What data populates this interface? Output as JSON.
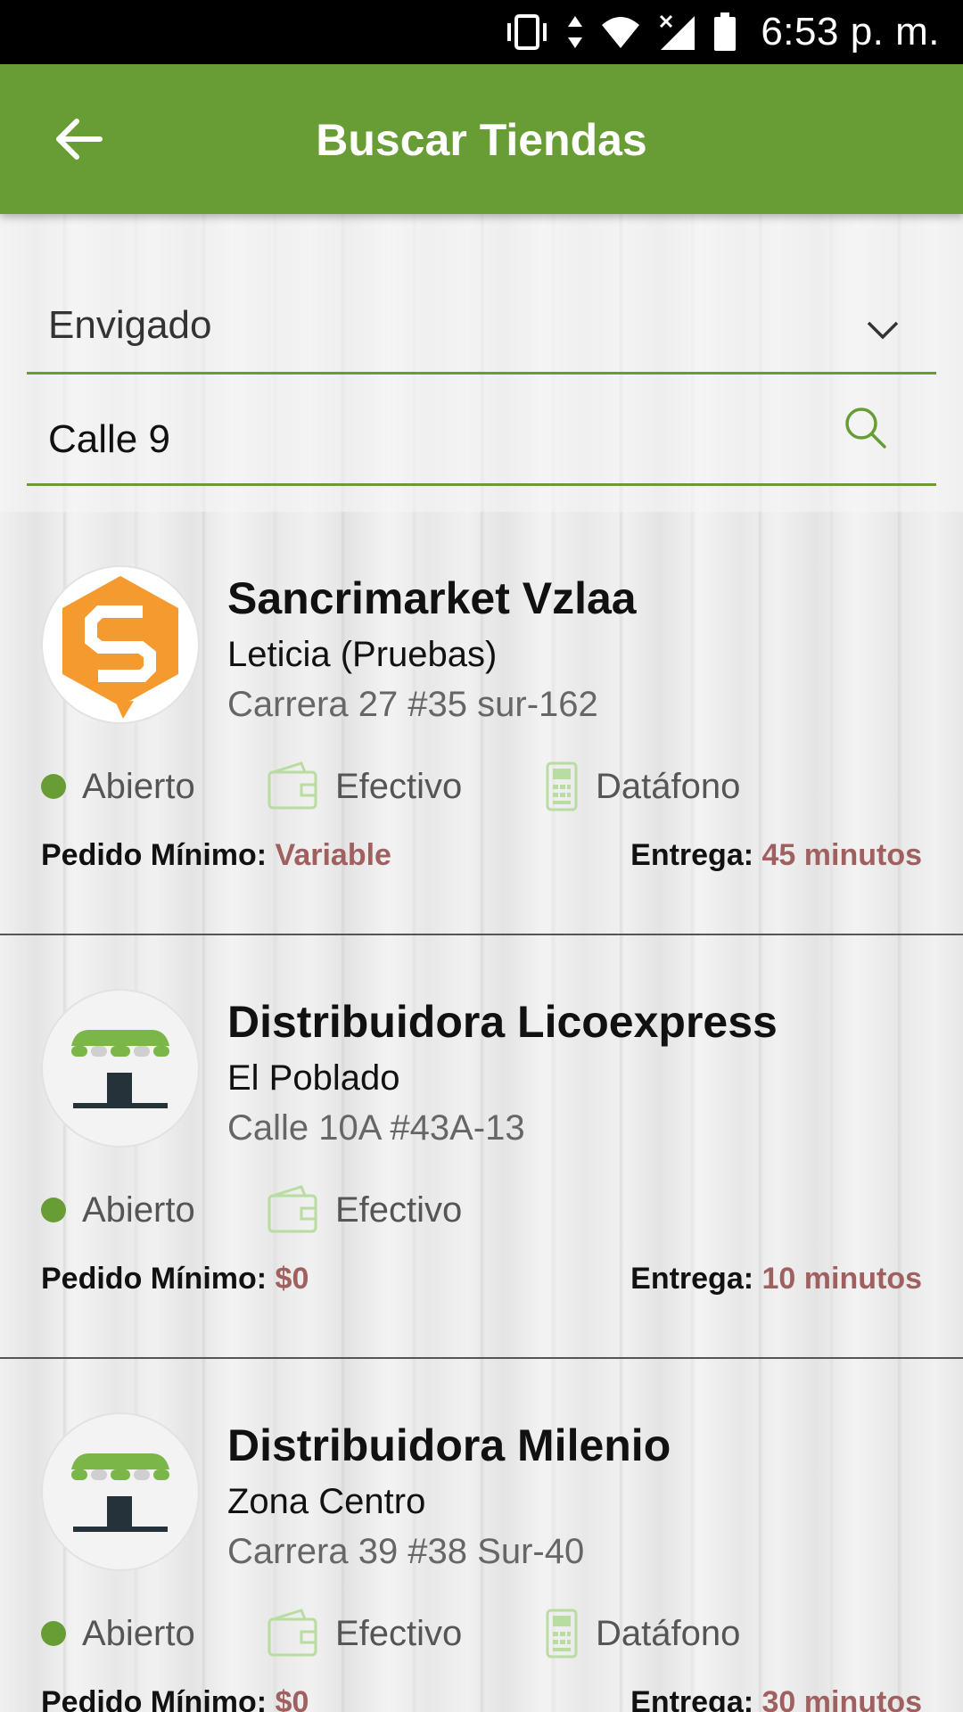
{
  "status_bar": {
    "time": "6:53 p. m.",
    "icons": [
      "vibrate-icon",
      "data-arrows-icon",
      "wifi-icon",
      "cell-signal-icon",
      "battery-icon"
    ]
  },
  "app_bar": {
    "title": "Buscar Tiendas",
    "back_icon": "arrow-left-icon",
    "color": "#689c35"
  },
  "filters": {
    "city_selected": "Envigado",
    "search_value": "Calle 9"
  },
  "stores": [
    {
      "name": "Sancrimarket Vzlaa",
      "zone": "Leticia (Pruebas)",
      "address": "Carrera 27 #35 sur-162",
      "logo": "sancrimarket-logo",
      "status": "Abierto",
      "payments": [
        "Efectivo",
        "Datáfono"
      ],
      "min_order_label": "Pedido Mínimo:",
      "min_order_value": "Variable",
      "delivery_label": "Entrega:",
      "delivery_value": "45 minutos"
    },
    {
      "name": "Distribuidora Licoexpress",
      "zone": "El Poblado",
      "address": "Calle 10A #43A-13",
      "logo": "storefront-icon",
      "status": "Abierto",
      "payments": [
        "Efectivo"
      ],
      "min_order_label": "Pedido Mínimo:",
      "min_order_value": "$0",
      "delivery_label": "Entrega:",
      "delivery_value": "10 minutos"
    },
    {
      "name": "Distribuidora Milenio",
      "zone": "Zona Centro",
      "address": "Carrera 39 #38 Sur-40",
      "logo": "storefront-icon",
      "status": "Abierto",
      "payments": [
        "Efectivo",
        "Datáfono"
      ],
      "min_order_label": "Pedido Mínimo:",
      "min_order_value": "$0",
      "delivery_label": "Entrega:",
      "delivery_value": "30 minutos"
    }
  ]
}
